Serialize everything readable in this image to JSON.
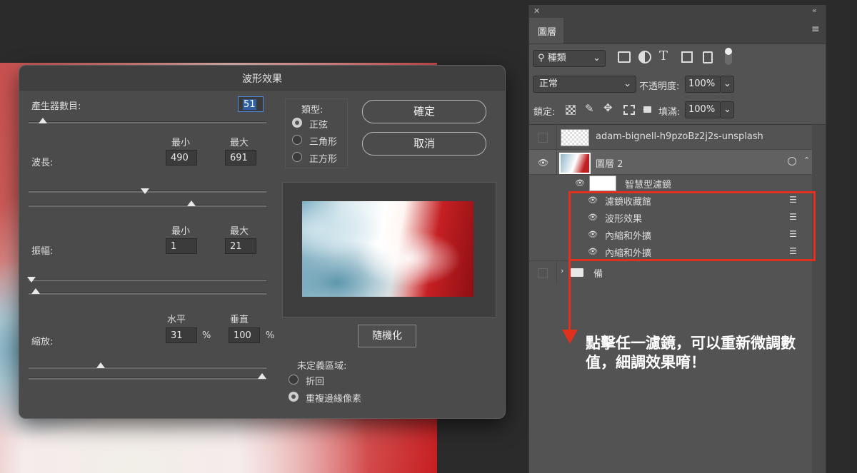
{
  "dialog": {
    "title": "波形效果",
    "generators_label": "產生器數目:",
    "generators_value": "51",
    "wavelength_label": "波長:",
    "amplitude_label": "振幅:",
    "scale_label": "縮放:",
    "min_label": "最小",
    "max_label": "最大",
    "wavelength_min": "490",
    "wavelength_max": "691",
    "amplitude_min": "1",
    "amplitude_max": "21",
    "horizontal_label": "水平",
    "vertical_label": "垂直",
    "scale_h": "31",
    "scale_v": "100",
    "percent": "%",
    "type_label": "類型:",
    "type_options": [
      "正弦",
      "三角形",
      "正方形"
    ],
    "ok_button": "確定",
    "cancel_button": "取消",
    "randomize_button": "隨機化",
    "undefined_label": "未定義區域:",
    "undefined_options": [
      "折回",
      "重複邊緣像素"
    ]
  },
  "panel": {
    "tab": "圖層",
    "kind_filter": "種類",
    "blend_mode": "正常",
    "opacity_label": "不透明度:",
    "opacity_value": "100%",
    "lock_label": "鎖定:",
    "fill_label": "填滿:",
    "fill_value": "100%",
    "layers": [
      {
        "name": "adam-bignell-h9pzoBz2j2s-unsplash"
      },
      {
        "name": "圖層 2"
      }
    ],
    "smart_filters_label": "智慧型濾鏡",
    "filters": [
      "濾鏡收藏館",
      "波形效果",
      "內縮和外擴",
      "內縮和外擴"
    ],
    "group_name": "備"
  },
  "annotation": {
    "line1": "點擊任一濾鏡，可以重新微調數",
    "line2": "值，細調效果唷！"
  },
  "colors": {
    "accent_red": "#e0301e",
    "selection_blue": "#2f5f9e"
  }
}
